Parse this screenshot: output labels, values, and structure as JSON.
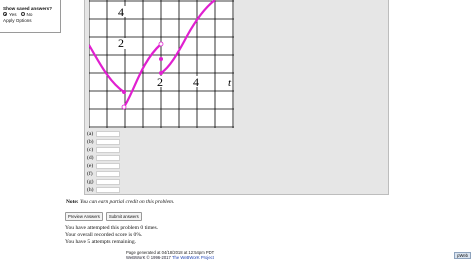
{
  "options": {
    "title": "Show saved answers?",
    "yes_label": "Yes",
    "no_label": "No",
    "selected": "yes",
    "apply_label": "Apply Options"
  },
  "graph": {
    "tick_labels": {
      "y4": "4",
      "y2": "2",
      "x2": "2",
      "x4": "4",
      "axis_var": "t"
    },
    "colors": {
      "curve": "#e020d0",
      "grid": "#000000",
      "background": "#ffffff"
    }
  },
  "answers": {
    "labels": [
      "(a)",
      "(b)",
      "(c)",
      "(d)",
      "(e)",
      "(f)",
      "(g)",
      "(h)"
    ]
  },
  "note": {
    "bold": "Note:",
    "text": "You can earn partial credit on this problem."
  },
  "buttons": {
    "preview": "Preview Answers",
    "submit": "Submit answers"
  },
  "status": {
    "line1": "You have attempted this problem 0 times.",
    "line2": "Your overall recorded score is 0%.",
    "line3": "You have 5 attempts remaining."
  },
  "footer": {
    "generated": "Page generated at 04/18/2018 at 12:54pm PDT",
    "credit": "WeBWorK © 1996-2017",
    "link": "The WeBWorK Project"
  },
  "logo": "pWeb"
}
